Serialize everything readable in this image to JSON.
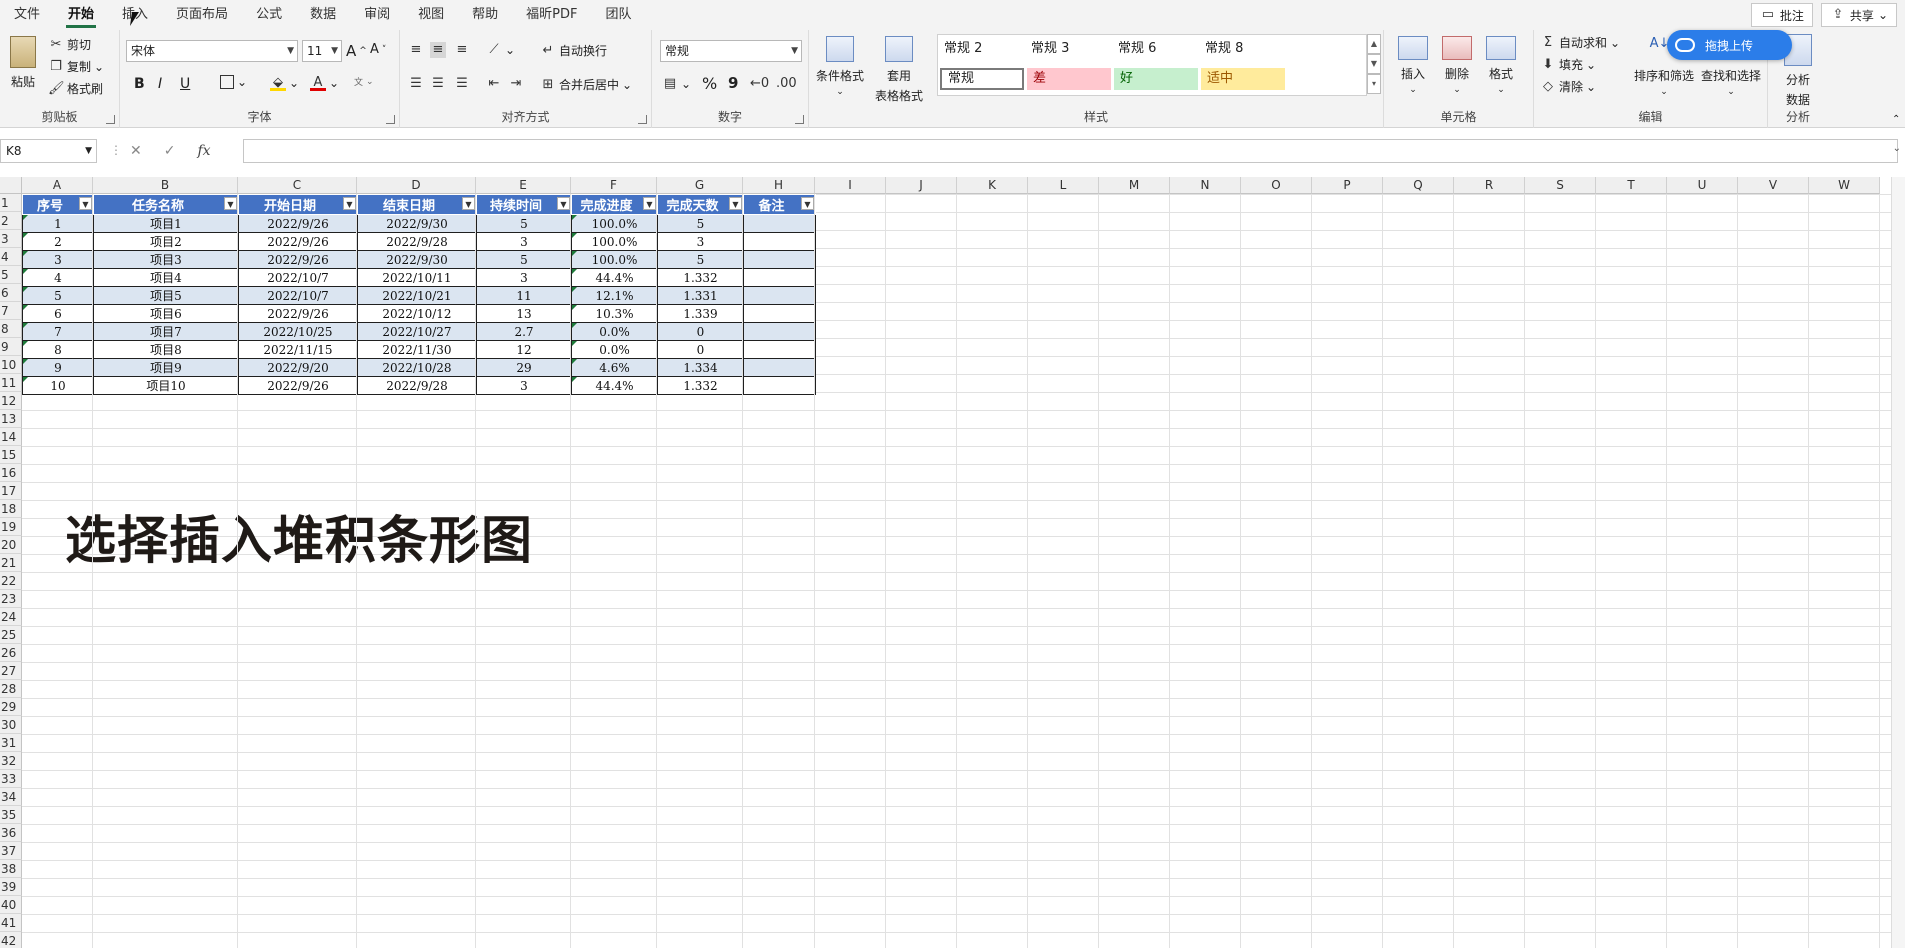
{
  "menu": {
    "tabs": [
      "文件",
      "开始",
      "插入",
      "页面布局",
      "公式",
      "数据",
      "审阅",
      "视图",
      "帮助",
      "福昕PDF",
      "团队"
    ],
    "active_index": 1
  },
  "topright": {
    "comment_label": "批注",
    "share_label": "共享"
  },
  "upload": {
    "label": "拖拽上传"
  },
  "ribbon": {
    "clipboard": {
      "label": "剪贴板",
      "paste": "粘贴",
      "cut": "剪切",
      "copy": "复制",
      "format_painter": "格式刷"
    },
    "font": {
      "label": "字体",
      "family": "宋体",
      "size": "11",
      "bold": "B",
      "italic": "I",
      "underline": "U",
      "grow": "A",
      "shrink": "A"
    },
    "alignment": {
      "label": "对齐方式",
      "wrap": "自动换行",
      "merge": "合并后居中"
    },
    "number": {
      "label": "数字",
      "format": "常规",
      "percent": "%",
      "comma": "9"
    },
    "styles": {
      "label": "样式",
      "conditional": "条件格式",
      "table_format_1": "套用",
      "table_format_2": "表格格式",
      "row1": [
        "常规 2",
        "常规 3",
        "常规 6",
        "常规 8"
      ],
      "row2": [
        {
          "name": "常规",
          "bg": "#ffffff"
        },
        {
          "name": "差",
          "bg": "#ffc7ce"
        },
        {
          "name": "好",
          "bg": "#c6efce"
        },
        {
          "name": "适中",
          "bg": "#ffeb9c"
        }
      ]
    },
    "cells": {
      "label": "单元格",
      "insert": "插入",
      "delete": "删除",
      "format": "格式"
    },
    "editing": {
      "label": "编辑",
      "autosum": "自动求和",
      "fill": "填充",
      "clear": "清除",
      "sort": "排序和筛选",
      "find": "查找和选择"
    },
    "analysis": {
      "label": "分析",
      "analyze_1": "分析",
      "analyze_2": "数据"
    }
  },
  "formula_bar": {
    "name_box": "K8",
    "fx": "fx",
    "value": ""
  },
  "columns": [
    "A",
    "B",
    "C",
    "D",
    "E",
    "F",
    "G",
    "H",
    "I",
    "J",
    "K",
    "L",
    "M",
    "N",
    "O",
    "P",
    "Q",
    "R",
    "S",
    "T",
    "U",
    "V",
    "W"
  ],
  "rows": [
    "1",
    "2",
    "3",
    "4",
    "5",
    "6",
    "7",
    "8",
    "9",
    "10",
    "11",
    "12",
    "13",
    "14",
    "15",
    "16",
    "17",
    "18",
    "19",
    "20",
    "21",
    "22",
    "23",
    "24",
    "25",
    "26",
    "27",
    "28",
    "29",
    "30",
    "31",
    "32",
    "33",
    "34",
    "35",
    "36",
    "37",
    "38",
    "39",
    "40",
    "41",
    "42"
  ],
  "table": {
    "headers": [
      "序号",
      "任务名称",
      "开始日期",
      "结束日期",
      "持续时间",
      "完成进度",
      "完成天数",
      "备注"
    ],
    "rows": [
      [
        "1",
        "项目1",
        "2022/9/26",
        "2022/9/30",
        "5",
        "100.0%",
        "5",
        ""
      ],
      [
        "2",
        "项目2",
        "2022/9/26",
        "2022/9/28",
        "3",
        "100.0%",
        "3",
        ""
      ],
      [
        "3",
        "项目3",
        "2022/9/26",
        "2022/9/30",
        "5",
        "100.0%",
        "5",
        ""
      ],
      [
        "4",
        "项目4",
        "2022/10/7",
        "2022/10/11",
        "3",
        "44.4%",
        "1.332",
        ""
      ],
      [
        "5",
        "项目5",
        "2022/10/7",
        "2022/10/21",
        "11",
        "12.1%",
        "1.331",
        ""
      ],
      [
        "6",
        "项目6",
        "2022/9/26",
        "2022/10/12",
        "13",
        "10.3%",
        "1.339",
        ""
      ],
      [
        "7",
        "项目7",
        "2022/10/25",
        "2022/10/27",
        "2.7",
        "0.0%",
        "0",
        ""
      ],
      [
        "8",
        "项目8",
        "2022/11/15",
        "2022/11/30",
        "12",
        "0.0%",
        "0",
        ""
      ],
      [
        "9",
        "项目9",
        "2022/9/20",
        "2022/10/28",
        "29",
        "4.6%",
        "1.334",
        ""
      ],
      [
        "10",
        "项目10",
        "2022/9/26",
        "2022/9/28",
        "3",
        "44.4%",
        "1.332",
        ""
      ]
    ]
  },
  "caption": "选择插入堆积条形图",
  "colors": {
    "header_bg": "#4472c4",
    "band_bg": "#dbe5f1",
    "accent": "#217346"
  }
}
